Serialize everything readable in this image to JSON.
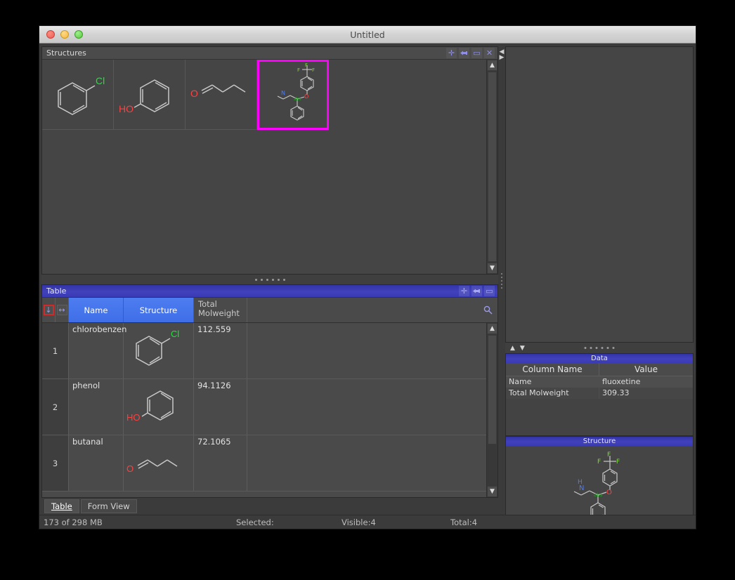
{
  "window": {
    "title": "Untitled",
    "traffic_lights": [
      "close-red",
      "minimize-yellow",
      "zoom-green"
    ]
  },
  "structures_panel": {
    "title": "Structures",
    "buttons": [
      {
        "name": "add-button",
        "glyph": "+"
      },
      {
        "name": "plug-button",
        "glyph": "⮜●"
      },
      {
        "name": "maximize-button",
        "glyph": "□"
      },
      {
        "name": "close-button",
        "glyph": "✕"
      }
    ],
    "cells": [
      {
        "name": "chlorobenzene",
        "selected": false
      },
      {
        "name": "phenol",
        "selected": false
      },
      {
        "name": "butanal",
        "selected": false
      },
      {
        "name": "fluoxetine",
        "selected": true
      }
    ],
    "selection_color": "#ff00ff"
  },
  "table_panel": {
    "title": "Table",
    "buttons": [
      {
        "name": "add-button",
        "glyph": "+"
      },
      {
        "name": "plug-button",
        "glyph": "⮜●"
      },
      {
        "name": "maximize-button",
        "glyph": "□"
      }
    ],
    "row_header_icons": [
      {
        "name": "sort-down-icon",
        "glyph": "↓",
        "highlighted": true
      },
      {
        "name": "resize-columns-icon",
        "glyph": "↔",
        "highlighted": false
      }
    ],
    "columns": [
      {
        "label": "Name",
        "selected": true
      },
      {
        "label": "Structure",
        "selected": true
      },
      {
        "label": "Total\nMolweight",
        "selected": false
      }
    ],
    "search_icon": "search-icon",
    "rows": [
      {
        "num": "1",
        "name": "chlorobenzen",
        "molweight": "112.559",
        "structure": "chlorobenzene"
      },
      {
        "num": "2",
        "name": "phenol",
        "molweight": "94.1126",
        "structure": "phenol"
      },
      {
        "num": "3",
        "name": "butanal",
        "molweight": "72.1065",
        "structure": "butanal"
      }
    ]
  },
  "tabs": [
    {
      "label": "Table",
      "active": true
    },
    {
      "label": "Form View",
      "active": false
    }
  ],
  "statusbar": {
    "memory": "173 of 298 MB",
    "selected": "Selected:",
    "visible": "Visible:4",
    "total": "Total:4"
  },
  "data_panel": {
    "title": "Data",
    "headers": {
      "column_name": "Column Name",
      "value": "Value"
    },
    "rows": [
      {
        "column_name": "Name",
        "value": "fluoxetine"
      },
      {
        "column_name": "Total Molweight",
        "value": "309.33"
      }
    ]
  },
  "structure_view": {
    "title": "Structure",
    "molecule": "fluoxetine"
  },
  "atom_colors": {
    "chlorine": "#22e03c",
    "oxygen": "#ff4040",
    "nitrogen": "#4a7bff",
    "fluorine": "#7ad93a",
    "stereo": "#22a022",
    "bond": "#c8c8c8"
  }
}
